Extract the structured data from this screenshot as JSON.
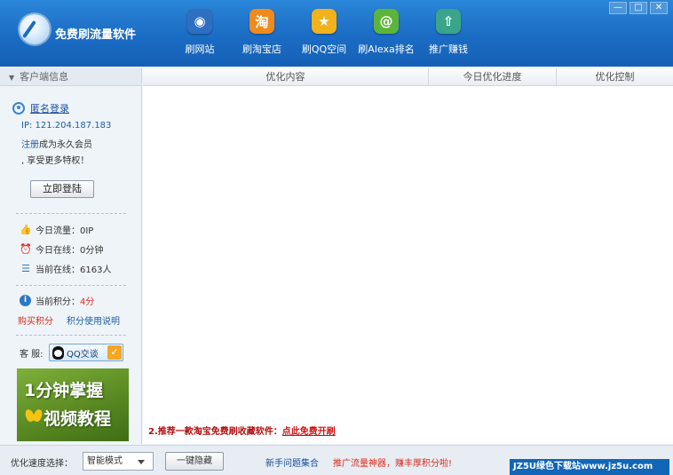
{
  "app": {
    "title": "免费刷流量软件"
  },
  "nav": [
    {
      "label": "刷网站",
      "icon": "globe-icon",
      "color": "#2f6fc2",
      "glyph": "◉"
    },
    {
      "label": "刷淘宝店",
      "icon": "taobao-icon",
      "color": "#f08a1c",
      "glyph": "淘"
    },
    {
      "label": "刷QQ空间",
      "icon": "star-icon",
      "color": "#f2b21c",
      "glyph": "★"
    },
    {
      "label": "刷Alexa排名",
      "icon": "alexa-icon",
      "color": "#5cb53a",
      "glyph": "@"
    },
    {
      "label": "推广赚钱",
      "icon": "rocket-icon",
      "color": "#3aa58a",
      "glyph": "⇧"
    }
  ],
  "window": {
    "minimize": "—",
    "maximize": "□",
    "close": "✕"
  },
  "sidebar": {
    "header": "客户端信息",
    "anonymous_login": "匿名登录",
    "ip": "IP: 121.204.187.183",
    "register": "注册",
    "promo_text1": "成为永久会员",
    "promo_text2": ", 享受更多特权！",
    "login_button": "立即登陆",
    "today_traffic": "今日流量：0IP",
    "today_online": "今日在线：0分钟",
    "current_online": "当前在线：6163人",
    "points_label": "当前积分：",
    "points_value": "4分",
    "buy_points": "购买积分",
    "points_usage": "积分使用说明",
    "service_label": "客 服:",
    "qq_chat": "QQ交谈",
    "video_line1": "1分钟掌握",
    "video_line2": "视频教程"
  },
  "table": {
    "headers": [
      "优化内容",
      "今日优化进度",
      "优化控制"
    ],
    "promo_prefix": "2.推荐一款淘宝免费刷收藏软件：",
    "promo_link": "点此免费开刷"
  },
  "footer": {
    "speed_label": "优化速度选择：",
    "speed_value": "智能模式",
    "hide_button": "一键隐藏",
    "faq": "新手问题集合",
    "promote": "推广流量神器，赚丰厚积分啦!",
    "watermark": "JZ5U绿色下载站www.jz5u.com"
  }
}
